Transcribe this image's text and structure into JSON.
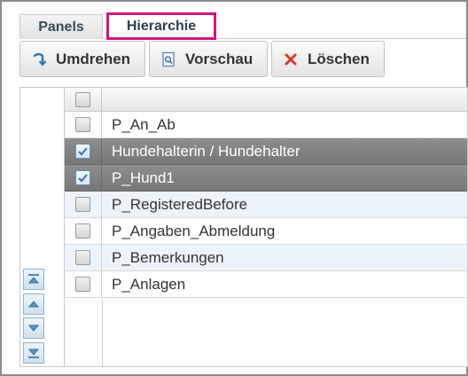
{
  "tabs": [
    {
      "label": "Panels",
      "active": false
    },
    {
      "label": "Hierarchie",
      "active": true
    }
  ],
  "toolbar": {
    "flip_label": "Umdrehen",
    "preview_label": "Vorschau",
    "delete_label": "Löschen"
  },
  "grid": {
    "header_text": "",
    "rows": [
      {
        "label": "P_An_Ab",
        "checked": false,
        "selected": false
      },
      {
        "label": "Hundehalterin / Hundehalter",
        "checked": true,
        "selected": true
      },
      {
        "label": "P_Hund1",
        "checked": true,
        "selected": true
      },
      {
        "label": "P_RegisteredBefore",
        "checked": false,
        "selected": false
      },
      {
        "label": "P_Angaben_Abmeldung",
        "checked": false,
        "selected": false
      },
      {
        "label": "P_Bemerkungen",
        "checked": false,
        "selected": false
      },
      {
        "label": "P_Anlagen",
        "checked": false,
        "selected": false
      }
    ]
  },
  "order_controls": [
    "move-top-icon",
    "move-up-icon",
    "move-down-icon",
    "move-bottom-icon"
  ],
  "colors": {
    "active_tab_border": "#d4157a",
    "selected_row": "#808080",
    "alt_row": "#edf3fa",
    "delete_icon": "#d33a2c",
    "flip_icon": "#2b7bbf"
  }
}
